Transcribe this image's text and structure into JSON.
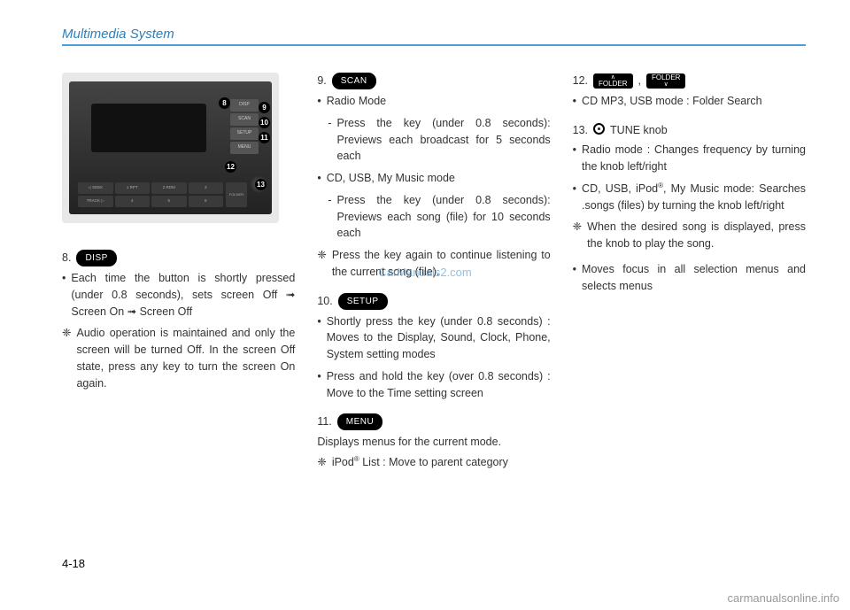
{
  "header": {
    "title": "Multimedia System"
  },
  "device": {
    "side_buttons": [
      "DISP",
      "SCAN",
      "SETUP",
      "MENU"
    ],
    "row1": [
      "◁ SEEK",
      "1 RPT",
      "2 RDM",
      "3"
    ],
    "row2": [
      "TRACK ▷",
      "4",
      "5",
      "6"
    ],
    "folder": "FOLDER",
    "knob_label": "TUNE",
    "callouts": {
      "c8": "8",
      "c9": "9",
      "c10": "10",
      "c11": "11",
      "c12": "12",
      "c13": "13"
    }
  },
  "col1": {
    "item8": {
      "num": "8.",
      "btn": "DISP",
      "b1": "Each time the button is shortly pressed (under 0.8 seconds), sets screen Off ➟ Screen On ➟ Screen Off",
      "n1": "Audio operation is maintained and only the screen will be turned Off. In the screen Off state, press any key to turn the screen On again."
    }
  },
  "col2": {
    "item9": {
      "num": "9.",
      "btn": "SCAN",
      "b1": "Radio Mode",
      "s1": "Press the key (under 0.8 seconds): Previews each broadcast for 5 seconds each",
      "b2": "CD, USB, My Music mode",
      "s2": "Press the key (under 0.8 seconds): Previews each song (file) for 10 seconds each",
      "n1": "Press the key again to continue listening to the current song (file)."
    },
    "item10": {
      "num": "10.",
      "btn": "SETUP",
      "b1": "Shortly press the key (under 0.8 seconds) : Moves to the Display, Sound, Clock, Phone, System setting modes",
      "b2": "Press and hold the key (over 0.8 seconds) : Move to the Time setting screen"
    },
    "item11": {
      "num": "11.",
      "btn": "MENU",
      "text": "Displays menus for the current mode.",
      "n1_prefix": "iPod",
      "n1_suffix": " List : Move to parent category"
    }
  },
  "col3": {
    "item12": {
      "num": "12.",
      "btn1": "FOLDER",
      "sep": ",",
      "btn2": "FOLDER",
      "b1": "CD MP3, USB mode : Folder Search"
    },
    "item13": {
      "num": "13.",
      "label": "TUNE knob",
      "b1": "Radio mode : Changes frequency by turning the knob left/right",
      "b2_prefix": "CD, USB, iPod",
      "b2_suffix": ", My Music mode: Searches .songs (files) by turning the knob left/right",
      "n1": "When the desired song is displayed, press the knob to play the song.",
      "b3": "Moves focus in all selection menus and selects menus"
    }
  },
  "page_num": "4-18",
  "watermark": "CarManuals2.com",
  "watermark_bottom": "carmanualsonline.info"
}
